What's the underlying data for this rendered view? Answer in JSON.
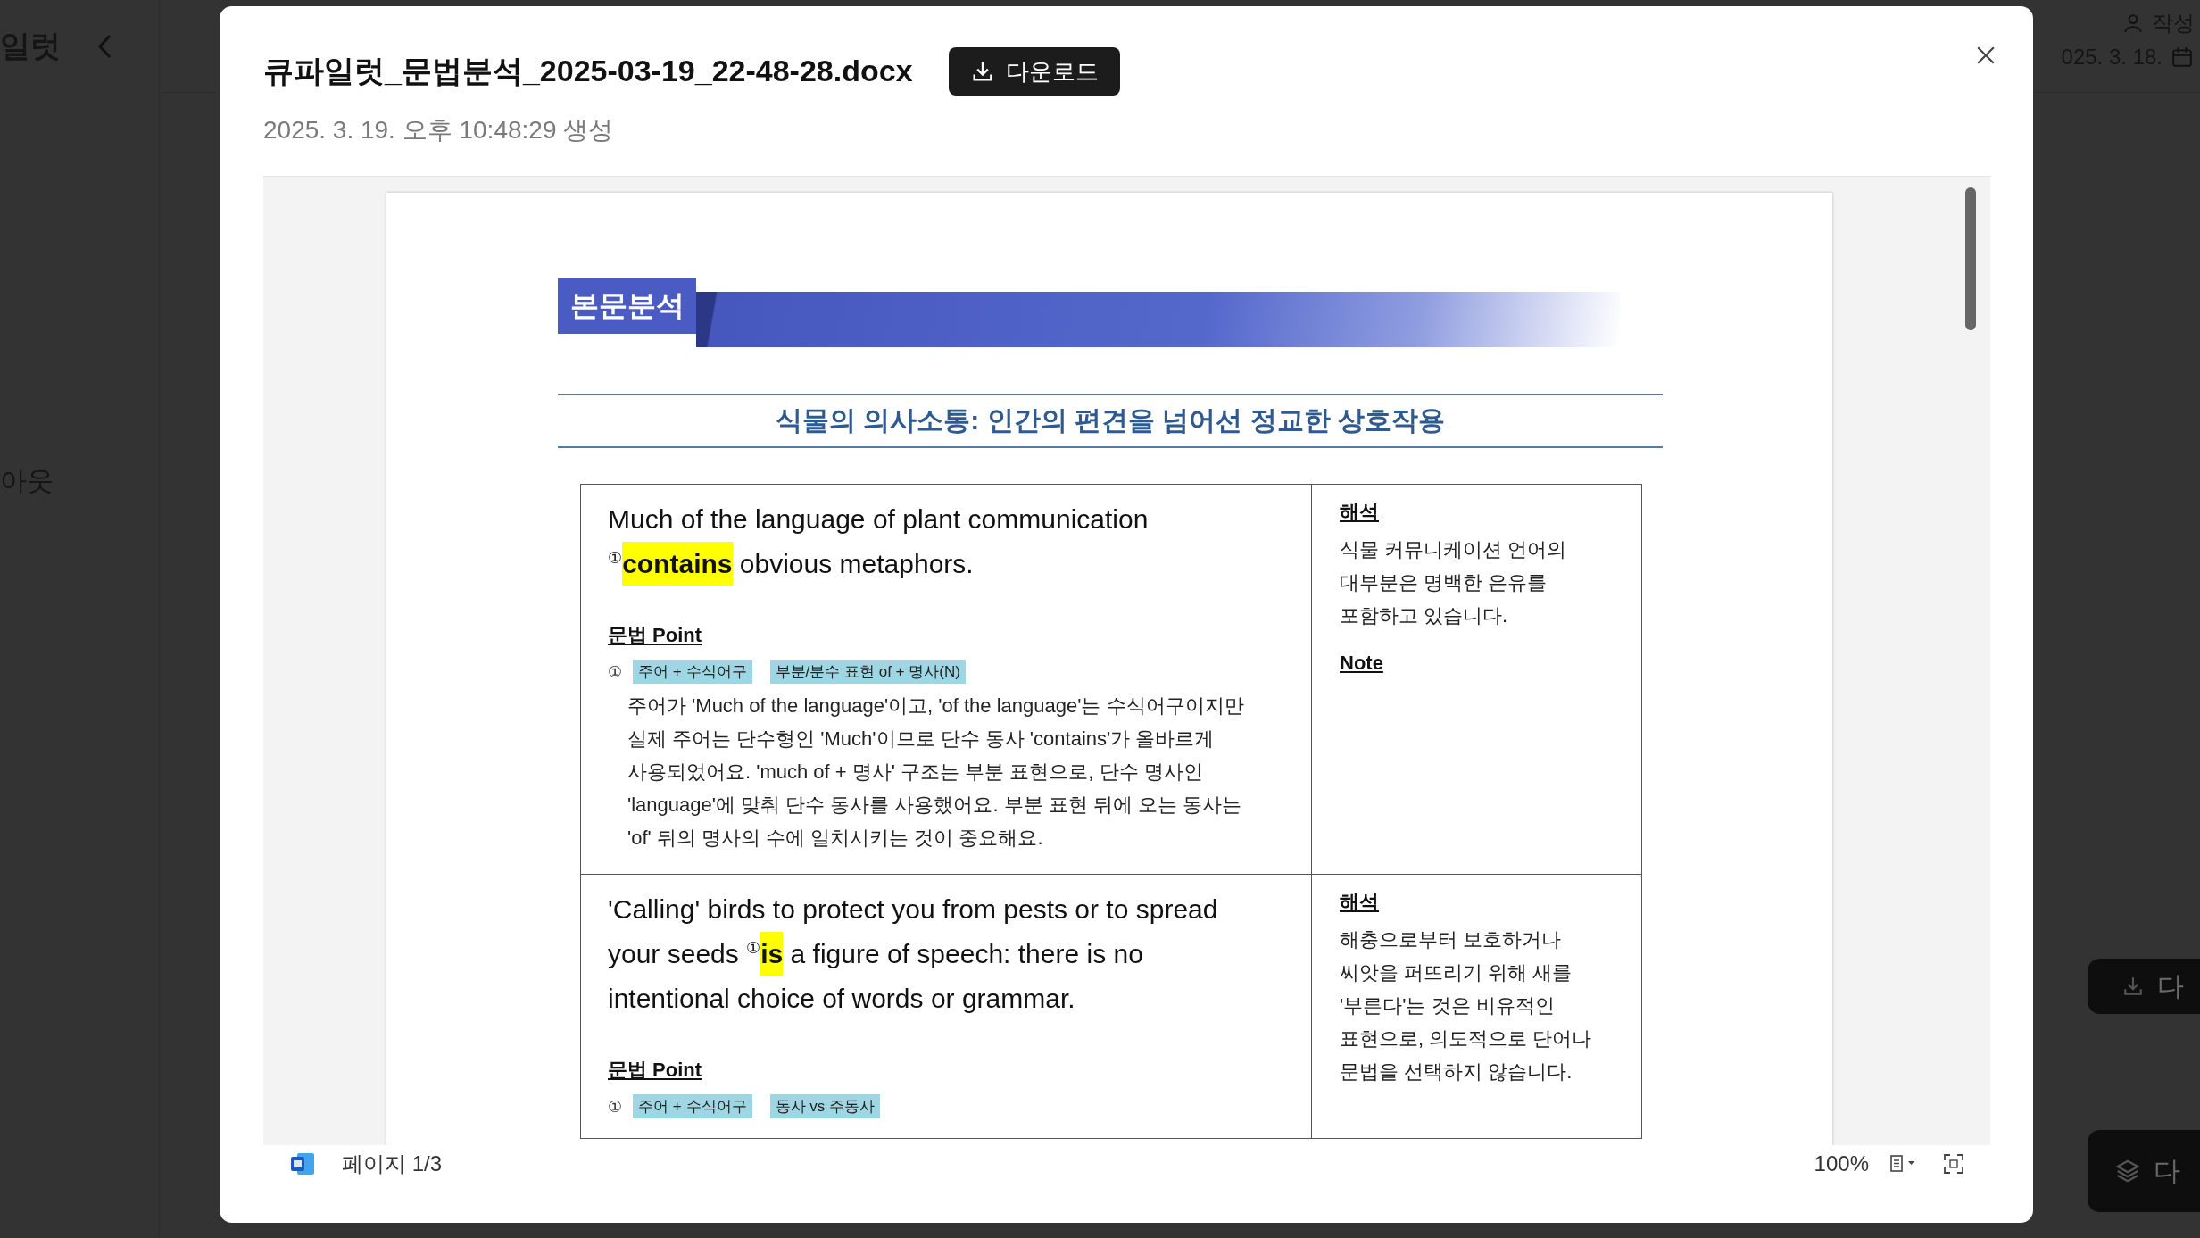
{
  "background": {
    "sidebar_title": "일럿",
    "sidebar_item": "아웃",
    "author_label": "작성",
    "date": "025. 3. 18.",
    "download_button": "다",
    "layers_button": "다"
  },
  "modal": {
    "title": "큐파일럿_문법분석_2025-03-19_22-48-28.docx",
    "download_button": "다운로드",
    "created": "2025. 3. 19. 오후 10:48:29 생성"
  },
  "document": {
    "section_label": "본문분석",
    "heading": "식물의 의사소통: 인간의 편견을 넘어선 정교한 상호작용",
    "rows": [
      {
        "sentence": [
          {
            "kind": "plain",
            "text": "Much of the language of plant communication "
          },
          {
            "kind": "marker",
            "text": "①"
          },
          {
            "kind": "highlight",
            "text": "contains"
          },
          {
            "kind": "plain",
            "text": " obvious metaphors."
          }
        ],
        "grammar_title": "문법 Point",
        "grammar_points": [
          {
            "number": "①",
            "tags": [
              "주어 + 수식어구",
              "부분/분수 표현 of + 명사(N)"
            ],
            "explanation": "주어가 'Much of the language'이고, 'of the language'는 수식어구이지만 실제 주어는 단수형인 'Much'이므로 단수 동사 'contains'가 올바르게 사용되었어요. 'much of + 명사' 구조는 부분 표현으로, 단수 명사인 'language'에 맞춰 단수 동사를 사용했어요. 부분 표현 뒤에 오는 동사는 'of' 뒤의 명사의 수에 일치시키는 것이 중요해요."
          }
        ],
        "translation_title": "해석",
        "translation": "식물 커뮤니케이션 언어의 대부분은 명백한 은유를 포함하고 있습니다.",
        "note_title": "Note"
      },
      {
        "sentence": [
          {
            "kind": "plain",
            "text": "'Calling' birds to protect you from pests or to spread your seeds "
          },
          {
            "kind": "marker",
            "text": "①"
          },
          {
            "kind": "highlight",
            "text": "is"
          },
          {
            "kind": "plain",
            "text": " a figure of speech: there is no intentional choice of words or grammar."
          }
        ],
        "grammar_title": "문법 Point",
        "grammar_points": [
          {
            "number": "①",
            "tags": [
              "주어 + 수식어구",
              "동사 vs 주동사"
            ]
          }
        ],
        "translation_title": "해석",
        "translation": "해충으로부터 보호하거나 씨앗을 퍼뜨리기 위해 새를 '부른다'는 것은 비유적인 표현으로, 의도적으로 단어나 문법을 선택하지 않습니다."
      }
    ]
  },
  "viewer_bar": {
    "page": "페이지 1/3",
    "zoom": "100%"
  }
}
